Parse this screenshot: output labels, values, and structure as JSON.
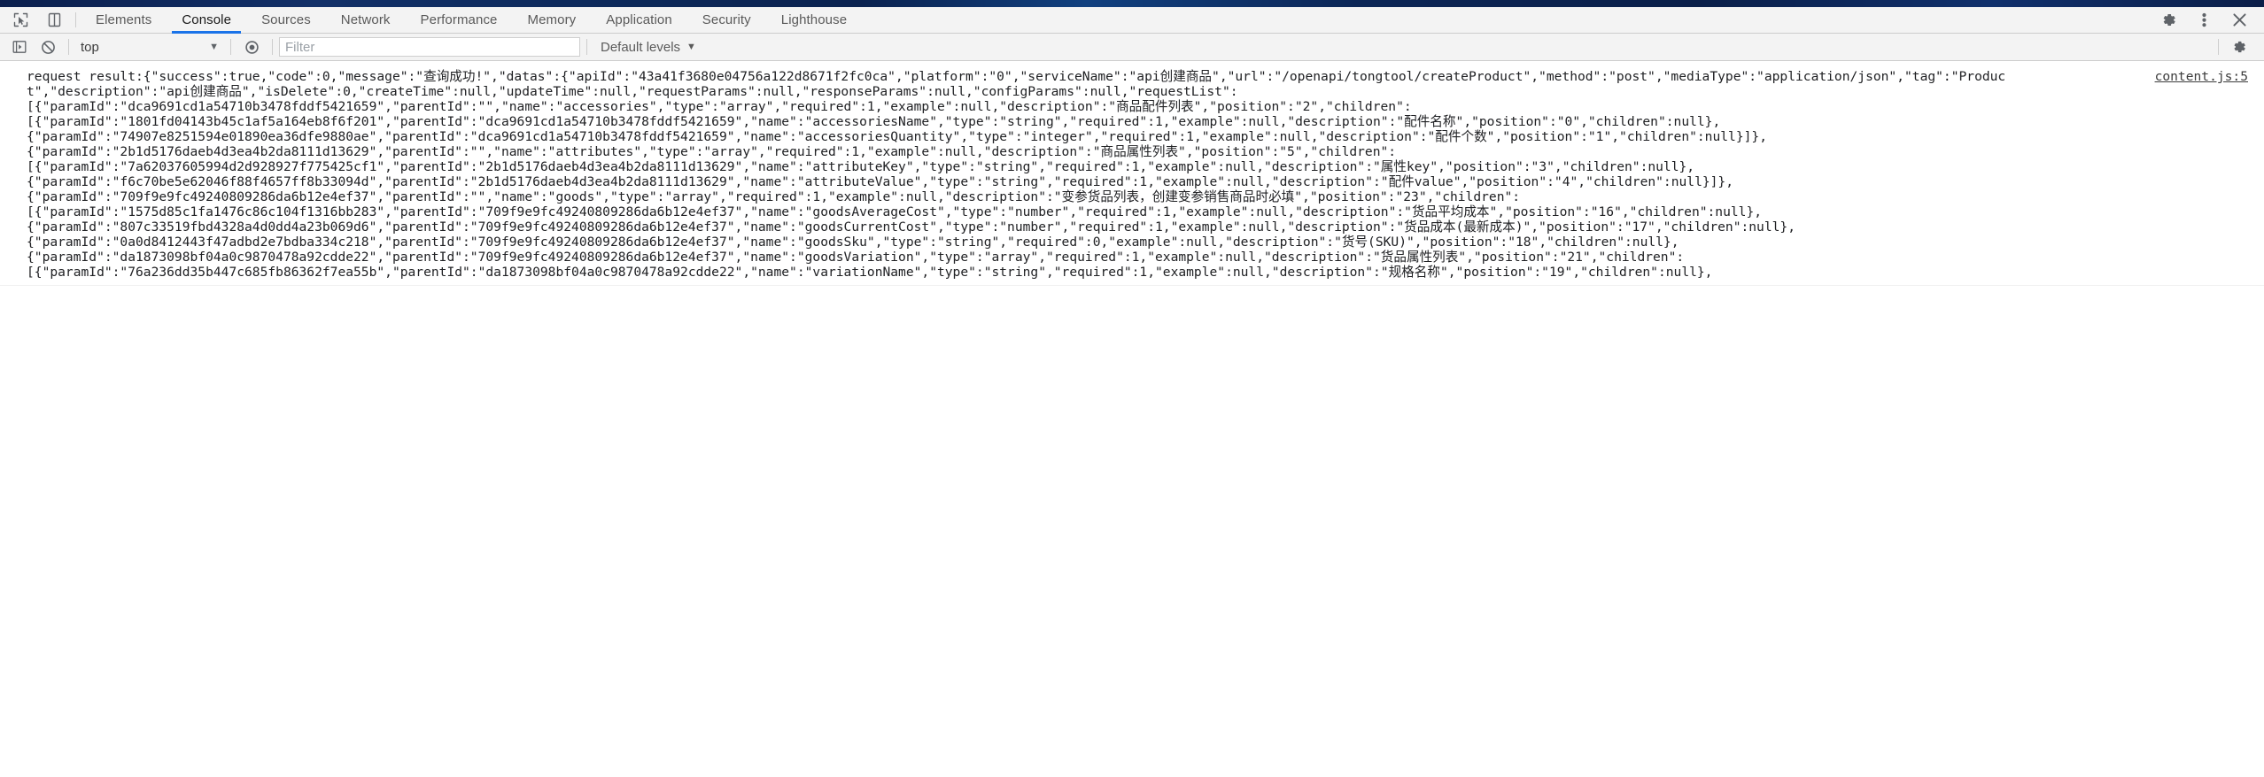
{
  "window": {
    "top_strip_color": "#0b2049"
  },
  "devtools": {
    "toolbar": {
      "inspect_label": "Inspect element",
      "device_toggle_label": "Toggle device toolbar",
      "settings_label": "Settings",
      "more_label": "Customize and control DevTools",
      "close_label": "Close DevTools"
    },
    "tabs": [
      {
        "label": "Elements",
        "active": false
      },
      {
        "label": "Console",
        "active": true
      },
      {
        "label": "Sources",
        "active": false
      },
      {
        "label": "Network",
        "active": false
      },
      {
        "label": "Performance",
        "active": false
      },
      {
        "label": "Memory",
        "active": false
      },
      {
        "label": "Application",
        "active": false
      },
      {
        "label": "Security",
        "active": false
      },
      {
        "label": "Lighthouse",
        "active": false
      }
    ],
    "accent_color": "#1a73e8"
  },
  "console_toolbar": {
    "sidebar_toggle_label": "Show console sidebar",
    "clear_label": "Clear console",
    "context": "top",
    "context_caret": "▼",
    "eye_label": "Create live expression",
    "filter_placeholder": "Filter",
    "filter_value": "",
    "levels_label": "Default levels",
    "levels_caret": "▼",
    "settings_label": "Console settings"
  },
  "console": {
    "messages": [
      {
        "source": "content.js:5",
        "text": "request result:{\"success\":true,\"code\":0,\"message\":\"查询成功!\",\"datas\":{\"apiId\":\"43a41f3680e04756a122d8671f2fc0ca\",\"platform\":\"0\",\"serviceName\":\"api创建商品\",\"url\":\"/openapi/tongtool/createProduct\",\"method\":\"post\",\"mediaType\":\"application/json\",\"tag\":\"Product\",\"description\":\"api创建商品\",\"isDelete\":0,\"createTime\":null,\"updateTime\":null,\"requestParams\":null,\"responseParams\":null,\"configParams\":null,\"requestList\":\n[{\"paramId\":\"dca9691cd1a54710b3478fddf5421659\",\"parentId\":\"\",\"name\":\"accessories\",\"type\":\"array\",\"required\":1,\"example\":null,\"description\":\"商品配件列表\",\"position\":\"2\",\"children\":\n[{\"paramId\":\"1801fd04143b45c1af5a164eb8f6f201\",\"parentId\":\"dca9691cd1a54710b3478fddf5421659\",\"name\":\"accessoriesName\",\"type\":\"string\",\"required\":1,\"example\":null,\"description\":\"配件名称\",\"position\":\"0\",\"children\":null},\n{\"paramId\":\"74907e8251594e01890ea36dfe9880ae\",\"parentId\":\"dca9691cd1a54710b3478fddf5421659\",\"name\":\"accessoriesQuantity\",\"type\":\"integer\",\"required\":1,\"example\":null,\"description\":\"配件个数\",\"position\":\"1\",\"children\":null}]},\n{\"paramId\":\"2b1d5176daeb4d3ea4b2da8111d13629\",\"parentId\":\"\",\"name\":\"attributes\",\"type\":\"array\",\"required\":1,\"example\":null,\"description\":\"商品属性列表\",\"position\":\"5\",\"children\":\n[{\"paramId\":\"7a62037605994d2d928927f775425cf1\",\"parentId\":\"2b1d5176daeb4d3ea4b2da8111d13629\",\"name\":\"attributeKey\",\"type\":\"string\",\"required\":1,\"example\":null,\"description\":\"属性key\",\"position\":\"3\",\"children\":null},\n{\"paramId\":\"f6c70be5e62046f88f4657ff8b33094d\",\"parentId\":\"2b1d5176daeb4d3ea4b2da8111d13629\",\"name\":\"attributeValue\",\"type\":\"string\",\"required\":1,\"example\":null,\"description\":\"配件value\",\"position\":\"4\",\"children\":null}]},\n{\"paramId\":\"709f9e9fc49240809286da6b12e4ef37\",\"parentId\":\"\",\"name\":\"goods\",\"type\":\"array\",\"required\":1,\"example\":null,\"description\":\"变参货品列表，创建变参销售商品时必填\",\"position\":\"23\",\"children\":\n[{\"paramId\":\"1575d85c1fa1476c86c104f1316bb283\",\"parentId\":\"709f9e9fc49240809286da6b12e4ef37\",\"name\":\"goodsAverageCost\",\"type\":\"number\",\"required\":1,\"example\":null,\"description\":\"货品平均成本\",\"position\":\"16\",\"children\":null},\n{\"paramId\":\"807c33519fbd4328a4d0dd4a23b069d6\",\"parentId\":\"709f9e9fc49240809286da6b12e4ef37\",\"name\":\"goodsCurrentCost\",\"type\":\"number\",\"required\":1,\"example\":null,\"description\":\"货品成本(最新成本)\",\"position\":\"17\",\"children\":null},\n{\"paramId\":\"0a0d8412443f47adbd2e7bdba334c218\",\"parentId\":\"709f9e9fc49240809286da6b12e4ef37\",\"name\":\"goodsSku\",\"type\":\"string\",\"required\":0,\"example\":null,\"description\":\"货号(SKU)\",\"position\":\"18\",\"children\":null},\n{\"paramId\":\"da1873098bf04a0c9870478a92cdde22\",\"parentId\":\"709f9e9fc49240809286da6b12e4ef37\",\"name\":\"goodsVariation\",\"type\":\"array\",\"required\":1,\"example\":null,\"description\":\"货品属性列表\",\"position\":\"21\",\"children\":\n[{\"paramId\":\"76a236dd35b447c685fb86362f7ea55b\",\"parentId\":\"da1873098bf04a0c9870478a92cdde22\",\"name\":\"variationName\",\"type\":\"string\",\"required\":1,\"example\":null,\"description\":\"规格名称\",\"position\":\"19\",\"children\":null},"
      }
    ]
  }
}
